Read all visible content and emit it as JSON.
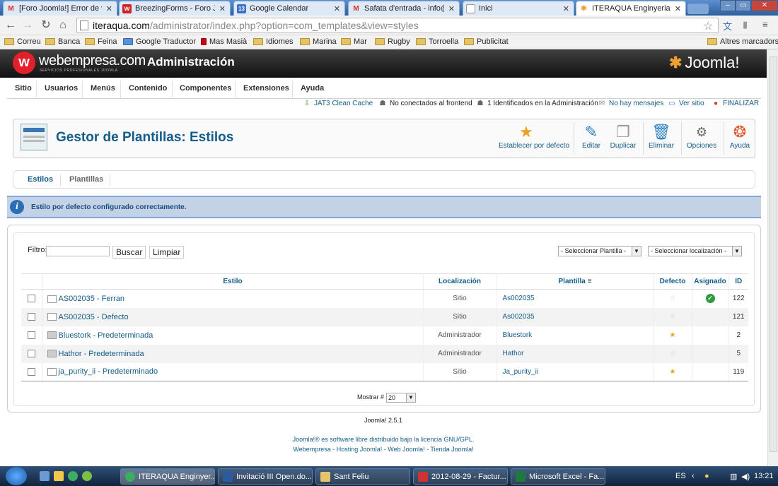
{
  "browser": {
    "tabs": [
      {
        "title": "[Foro Joomla!] Error de v",
        "active": false
      },
      {
        "title": "BreezingForms - Foro Jo",
        "active": false
      },
      {
        "title": "Google Calendar",
        "active": false
      },
      {
        "title": "Safata d'entrada - info@",
        "active": false
      },
      {
        "title": "Inici",
        "active": false
      },
      {
        "title": "ITERAQUA Enginyeria, C",
        "active": true
      }
    ],
    "url_domain": "iteraqua.com",
    "url_path": "/administrator/index.php?option=com_templates&view=styles",
    "bookmarks": [
      "Correu",
      "Banca",
      "Feina",
      "Google Traductor",
      "Mas Masià",
      "Idiomes",
      "Marina",
      "Mar",
      "Rugby",
      "Torroella",
      "Publicitat"
    ],
    "other_bookmarks": "Altres marcadors"
  },
  "header": {
    "brand": "webempresa.com",
    "brand_sub": "SERVICIOS PROFESIONALES JOOMLA",
    "title": "Administración",
    "joomla": "Joomla!"
  },
  "menu": [
    "Sitio",
    "Usuarios",
    "Menús",
    "Contenido",
    "Componentes",
    "Extensiones",
    "Ayuda"
  ],
  "status": {
    "cache": "JAT3 Clean Cache",
    "frontend": "No conectados al frontend",
    "admin": "1 Identificados en la Administración",
    "messages": "No hay mensajes",
    "view_site": "Ver sitio",
    "logout": "FINALIZAR"
  },
  "toolbar": {
    "title": "Gestor de Plantillas: Estilos",
    "buttons": {
      "default": "Establecer por defecto",
      "edit": "Editar",
      "duplicate": "Duplicar",
      "delete": "Eliminar",
      "options": "Opciones",
      "help": "Ayuda"
    }
  },
  "submenu": [
    "Estilos",
    "Plantillas"
  ],
  "message": "Estilo por defecto configurado correctamente.",
  "filter": {
    "label": "Filtro:",
    "value": "",
    "search": "Buscar",
    "clear": "Limpiar",
    "template_select": "- Seleccionar Plantilla -",
    "location_select": "- Seleccionar localización -"
  },
  "table": {
    "headers": {
      "style": "Estilo",
      "location": "Localización",
      "template": "Plantilla",
      "default": "Defecto",
      "assigned": "Asignado",
      "id": "ID"
    },
    "rows": [
      {
        "style": "AS002035 - Ferran",
        "location": "Sitio",
        "template": "As002035",
        "default": false,
        "assigned": true,
        "id": "122"
      },
      {
        "style": "AS002035 - Defecto",
        "location": "Sitio",
        "template": "As002035",
        "default": false,
        "assigned": false,
        "id": "121"
      },
      {
        "style": "Bluestork - Predeterminada",
        "location": "Administrador",
        "template": "Bluestork",
        "default": true,
        "assigned": false,
        "id": "2"
      },
      {
        "style": "Hathor - Predeterminada",
        "location": "Administrador",
        "template": "Hathor",
        "default": false,
        "assigned": false,
        "id": "5"
      },
      {
        "style": "ja_purity_ii - Predeterminado",
        "location": "Sitio",
        "template": "Ja_purity_ii",
        "default": true,
        "assigned": false,
        "id": "119"
      }
    ]
  },
  "pagination": {
    "label": "Mostrar #",
    "value": "20"
  },
  "footer": {
    "version": "Joomla! 2.5.1",
    "license": "Joomla!® es software libre distribuido bajo la licencia GNU/GPL.",
    "links": "Webempresa - Hosting Joomla! - Web Joomla! - Tienda Joomla!"
  },
  "taskbar": {
    "tasks": [
      "ITERAQUA Enginyer...",
      "Invitació III Open.do...",
      "Sant Feliu",
      "2012-08-29 - Factur...",
      "Microsoft Excel - Fa..."
    ],
    "lang": "ES",
    "clock": "13:21"
  }
}
